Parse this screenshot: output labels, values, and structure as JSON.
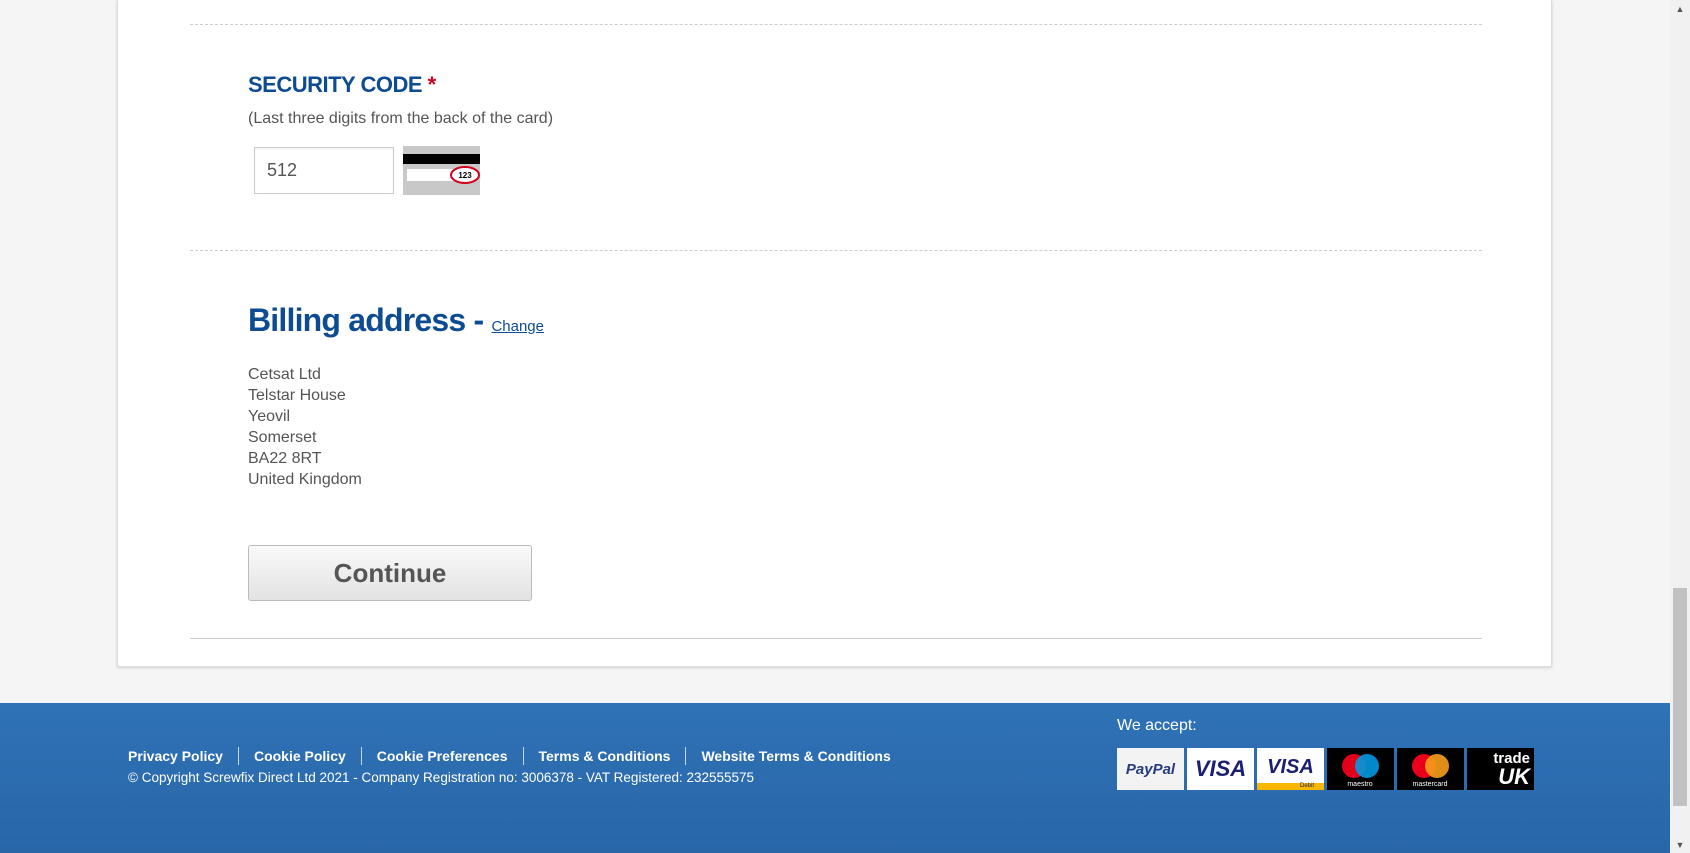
{
  "security": {
    "title": "SECURITY CODE",
    "required_mark": "*",
    "hint": "(Last three digits from the back of the card)",
    "value": "512",
    "card_example": "123"
  },
  "billing": {
    "heading": "Billing address -",
    "change_label": "Change",
    "address": [
      "Cetsat Ltd",
      "Telstar House",
      "Yeovil",
      "Somerset",
      "BA22 8RT",
      "United Kingdom"
    ]
  },
  "continue_label": "Continue",
  "footer": {
    "links": [
      "Privacy Policy",
      "Cookie Policy",
      "Cookie Preferences",
      "Terms & Conditions",
      "Website Terms & Conditions"
    ],
    "copyright": "© Copyright Screwfix Direct Ltd 2021 - Company Registration no: 3006378 - VAT Registered: 232555575",
    "accept_label": "We accept:",
    "payment_logos": [
      {
        "name": "paypal",
        "text": "PayPal"
      },
      {
        "name": "visa",
        "text": "VISA"
      },
      {
        "name": "visa-debit",
        "text": "VISA",
        "sub": "Debit"
      },
      {
        "name": "maestro",
        "text": "maestro"
      },
      {
        "name": "mastercard",
        "text": "mastercard"
      },
      {
        "name": "trade-uk",
        "text": "trade",
        "sub": "UK"
      }
    ]
  },
  "colors": {
    "brand_blue": "#0d4c93",
    "footer_blue": "#2f72b6",
    "required_red": "#d1001c"
  }
}
